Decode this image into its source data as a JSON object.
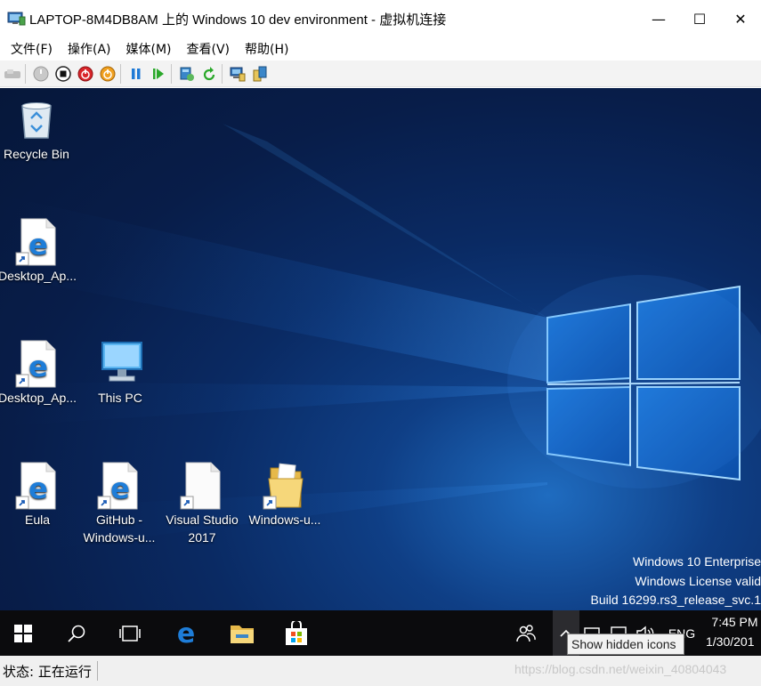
{
  "window": {
    "title": "LAPTOP-8M4DB8AM 上的 Windows 10 dev environment - 虚拟机连接",
    "minimize": "—",
    "maximize": "☐",
    "close": "✕"
  },
  "menu": [
    "文件(F)",
    "操作(A)",
    "媒体(M)",
    "查看(V)",
    "帮助(H)"
  ],
  "desktop_icons": [
    {
      "label": "Recycle Bin",
      "icon": "recycle-bin-icon"
    },
    {
      "label": "Desktop_Ap...",
      "icon": "edge-shortcut-icon"
    },
    {
      "label": "Desktop_Ap...",
      "icon": "edge-shortcut-icon"
    },
    {
      "label": "This PC",
      "icon": "computer-icon"
    },
    {
      "label": "Eula",
      "icon": "edge-shortcut-icon"
    },
    {
      "label": "GitHub - Windows-u...",
      "icon": "edge-shortcut-icon"
    },
    {
      "label": "Visual Studio 2017",
      "icon": "blank-document-shortcut-icon"
    },
    {
      "label": "Windows-u...",
      "icon": "folder-shortcut-icon"
    }
  ],
  "edition": {
    "line1": "Windows 10 Enterprise",
    "line2": "Windows License valid",
    "line3": "Build 16299.rs3_release_svc.1"
  },
  "tray": {
    "lang": "ENG",
    "time": "7:45 PM",
    "date": "1/30/201",
    "tooltip": "Show hidden icons"
  },
  "status": {
    "text": "状态: 正在运行"
  },
  "watermark": "https://blog.csdn.net/weixin_40804043",
  "colors": {
    "desktop_bg": "#081d49",
    "taskbar_bg": "#0b0b0d",
    "edge_blue": "#1e7dd8"
  }
}
